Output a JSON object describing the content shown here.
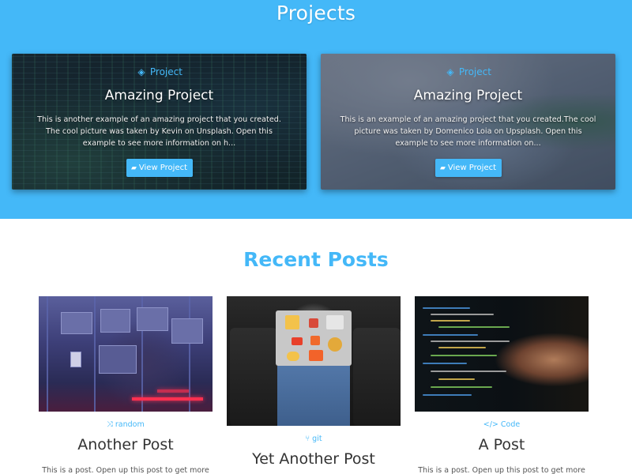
{
  "projects": {
    "title": "Projects",
    "cards": [
      {
        "tag": "Project",
        "tag_icon": "diamond-icon",
        "title": "Amazing Project",
        "description": "This is another example of an amazing project that you created. The cool picture was taken by Kevin on Unsplash. Open this example to see more information on h...",
        "button_label": "View Project",
        "button_icon": "folder-open-icon"
      },
      {
        "tag": "Project",
        "tag_icon": "diamond-icon",
        "title": "Amazing Project",
        "description": "This is an example of an amazing project that you created.The cool picture was taken by Domenico Loia on Upsplash. Open this example to see more information on...",
        "button_label": "View Project",
        "button_icon": "folder-open-icon"
      }
    ]
  },
  "recent_posts": {
    "title": "Recent Posts",
    "posts": [
      {
        "tag": "random",
        "tag_icon": "random-icon",
        "title": "Another Post",
        "excerpt": "This is a post. Open up this post to get more"
      },
      {
        "tag": "git",
        "tag_icon": "git-icon",
        "title": "Yet Another Post",
        "excerpt": ""
      },
      {
        "tag": "Code",
        "tag_icon": "code-icon",
        "title": "A Post",
        "excerpt": "This is a post. Open up this post to get more"
      }
    ]
  },
  "colors": {
    "accent": "#44b8f8",
    "band_background": "#44b8f8",
    "page_background": "#ffffff",
    "post_title": "#333333"
  }
}
